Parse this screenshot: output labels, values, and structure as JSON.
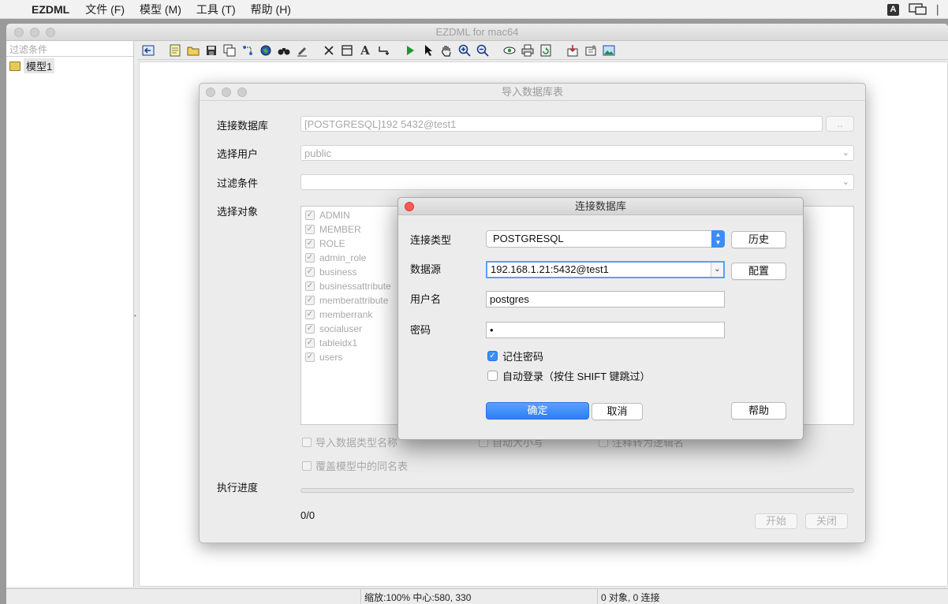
{
  "menubar": {
    "app": "EZDML",
    "items": [
      "文件 (F)",
      "模型 (M)",
      "工具 (T)",
      "帮助 (H)"
    ],
    "input_indicator": "A"
  },
  "window": {
    "title": "EZDML for mac64"
  },
  "sidebar": {
    "filter_placeholder": "过滤条件",
    "tree": [
      {
        "label": "模型1"
      }
    ]
  },
  "toolbar": {
    "icons": [
      "back-icon",
      "new-file-icon",
      "open-folder-icon",
      "save-icon",
      "copy-icon",
      "connect-icon",
      "globe-icon",
      "binoculars-icon",
      "edit-pen-icon",
      "delete-x-icon",
      "table-icon",
      "text-icon",
      "link-icon",
      "run-icon",
      "pointer-icon",
      "hand-icon",
      "zoom-in-icon",
      "zoom-out-icon",
      "eye-icon",
      "print-icon",
      "refresh-icon",
      "import-icon",
      "settings-icon",
      "image-icon"
    ]
  },
  "statusbar": {
    "zoom": "缩放:100% 中心:580, 330",
    "objects": "0 对象, 0 连接"
  },
  "import_dialog": {
    "title": "导入数据库表",
    "db_label": "连接数据库",
    "db_value": "[POSTGRESQL]192        5432@test1",
    "browse_button": "..",
    "user_label": "选择用户",
    "user_value": "public",
    "filter_label": "过滤条件",
    "filter_value": "",
    "objects_label": "选择对象",
    "objects": [
      "ADMIN",
      "MEMBER",
      "ROLE",
      "admin_role",
      "business",
      "businessattribute",
      "memberattribute",
      "memberrank",
      "socialuser",
      "tableidx1",
      "users"
    ],
    "opt_import_type_name": "导入数据类型名称",
    "opt_auto_case": "自动大小写",
    "opt_comment_to_name": "注释转为逻辑名",
    "opt_overwrite": "覆盖模型中的同名表",
    "progress_label": "执行进度",
    "progress": 0,
    "progress_count": "0/0",
    "start_button": "开始",
    "close_button": "关闭"
  },
  "connect_dialog": {
    "title": "连接数据库",
    "type_label": "连接类型",
    "type_value": "POSTGRESQL",
    "history_button": "历史",
    "source_label": "数据源",
    "source_value": "192.168.1.21:5432@test1",
    "config_button": "配置",
    "username_label": "用户名",
    "username_value": "postgres",
    "password_label": "密码",
    "password_value": "•",
    "remember_password": "记住密码",
    "remember_checked": true,
    "auto_login": "自动登录（按住 SHIFT 键跳过）",
    "auto_login_checked": false,
    "ok_button": "确定",
    "cancel_button": "取消",
    "help_button": "帮助"
  }
}
